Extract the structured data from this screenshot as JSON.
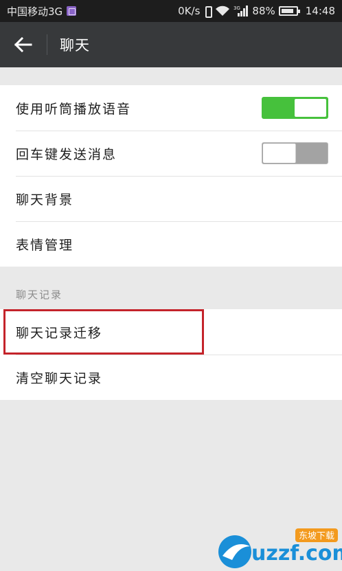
{
  "status_bar": {
    "carrier": "中国移动3G",
    "net_speed": "0K/s",
    "network_type": "3G",
    "battery": "88%",
    "time": "14:48",
    "icons": [
      "app-notification-icon",
      "vibrate-icon",
      "wifi-icon",
      "signal-icon",
      "battery-icon"
    ]
  },
  "header": {
    "back_icon": "arrow-left-icon",
    "title": "聊天"
  },
  "settings": {
    "group1": [
      {
        "label": "使用听筒播放语音",
        "toggle": true
      },
      {
        "label": "回车键发送消息",
        "toggle": false
      },
      {
        "label": "聊天背景"
      },
      {
        "label": "表情管理"
      }
    ],
    "section_header": "聊天记录",
    "group2": [
      {
        "label": "聊天记录迁移",
        "highlighted": true
      },
      {
        "label": "清空聊天记录"
      }
    ]
  },
  "watermark": {
    "brand": "uzzf.com",
    "tag": "东坡下载"
  },
  "colors": {
    "status_bar_bg": "#1d1d1d",
    "header_bg": "#37393b",
    "page_bg": "#e9e9e9",
    "toggle_on": "#46c13c",
    "toggle_off": "#a3a3a3",
    "highlight_border": "#c4232a"
  }
}
